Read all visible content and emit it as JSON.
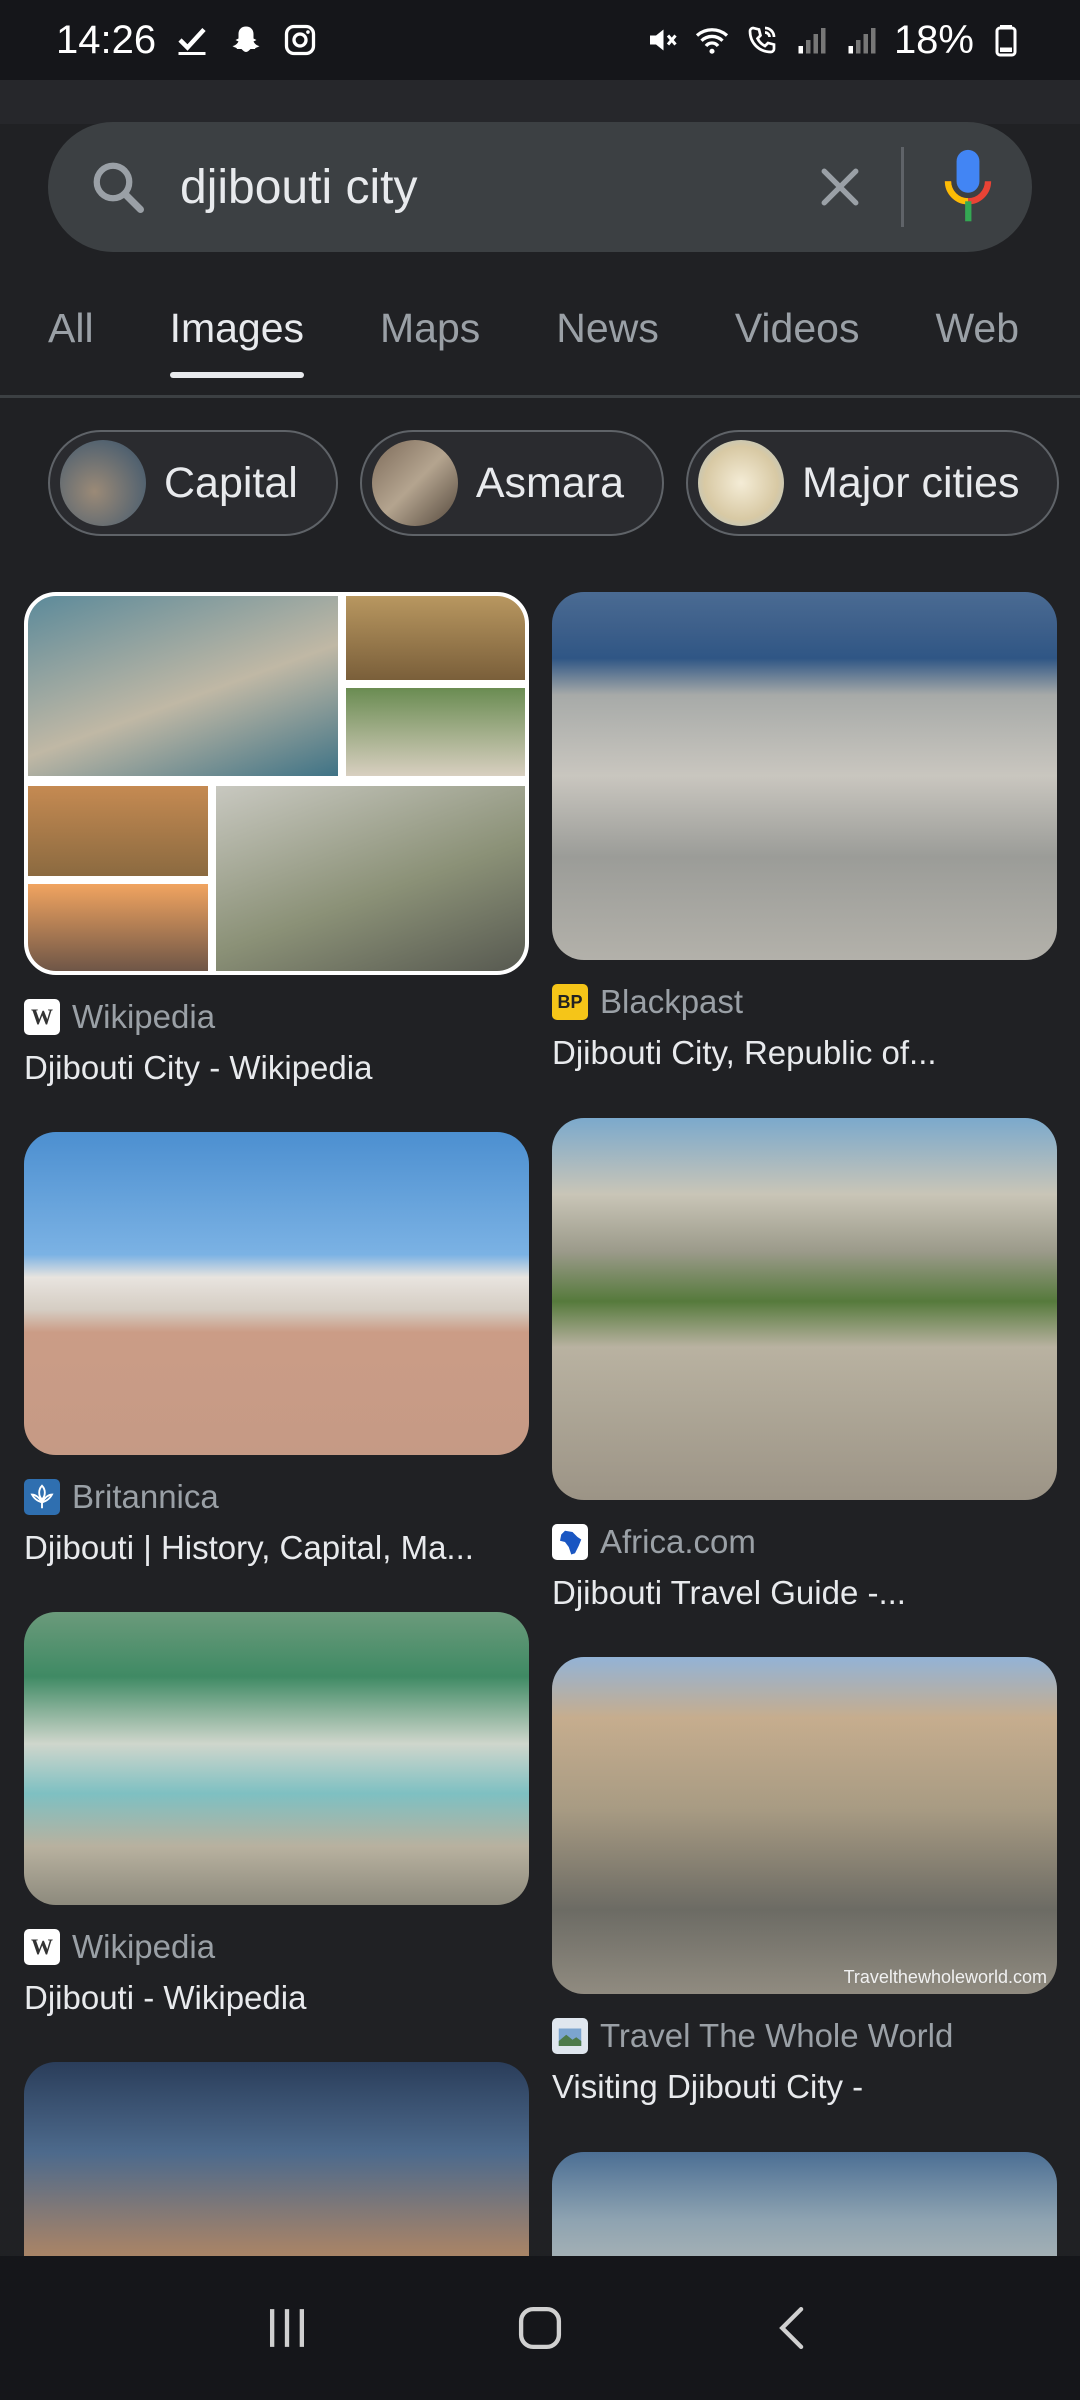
{
  "status": {
    "time": "14:26",
    "battery": "18%"
  },
  "search": {
    "query": "djibouti city"
  },
  "tabs": [
    {
      "label": "All"
    },
    {
      "label": "Images"
    },
    {
      "label": "Maps"
    },
    {
      "label": "News"
    },
    {
      "label": "Videos"
    },
    {
      "label": "Web"
    }
  ],
  "chips": [
    {
      "label": "Capital"
    },
    {
      "label": "Asmara"
    },
    {
      "label": "Major cities"
    }
  ],
  "results": [
    {
      "source": "Wikipedia",
      "title": "Djibouti City - Wikipedia",
      "favicon": "W"
    },
    {
      "source": "Blackpast",
      "title": "Djibouti City, Republic of...",
      "favicon": "BP"
    },
    {
      "source": "Britannica",
      "title": "Djibouti | History, Capital, Ma...",
      "favicon": "britannica-icon"
    },
    {
      "source": "Africa.com",
      "title": "Djibouti Travel Guide -...",
      "favicon": "africa-icon"
    },
    {
      "source": "Wikipedia",
      "title": "Djibouti - Wikipedia",
      "favicon": "W"
    },
    {
      "source": "Travel The Whole World",
      "title": "Visiting Djibouti City -",
      "favicon": "travel-icon",
      "watermark": "Travelthewholeworld.com"
    }
  ]
}
